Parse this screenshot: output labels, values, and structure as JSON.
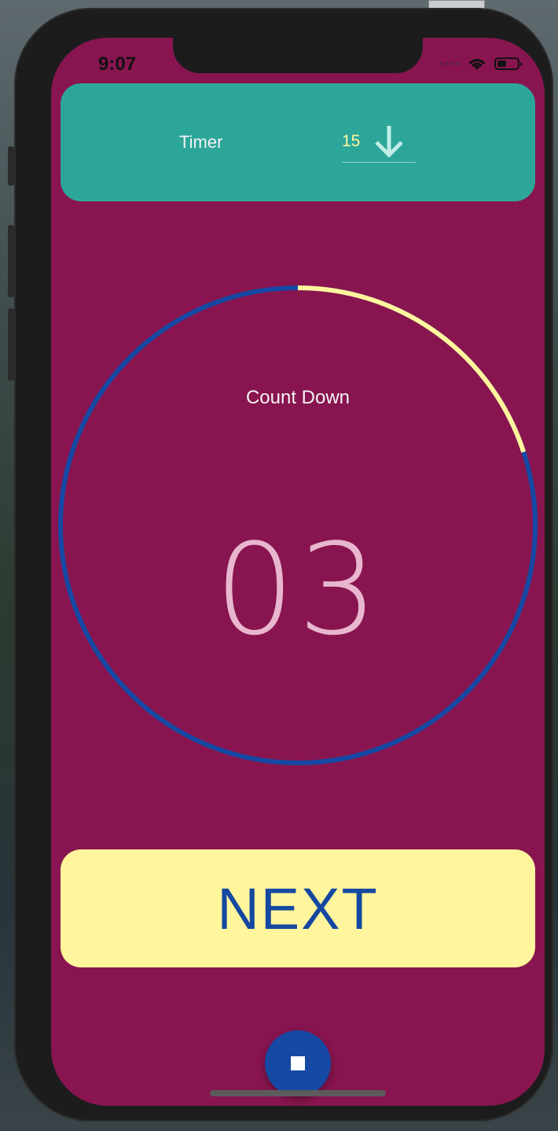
{
  "status_bar": {
    "time": "9:07"
  },
  "timer_card": {
    "label": "Timer",
    "selected_value": "15",
    "icon": "arrow-down-icon"
  },
  "countdown": {
    "label": "Count Down",
    "value": "03",
    "ring_progress_remaining": 0.2,
    "colors": {
      "track": "#1549a4",
      "progress": "#fff59d"
    }
  },
  "next_button": {
    "label": "NEXT"
  },
  "fab": {
    "icon": "stop-icon"
  },
  "colors": {
    "background": "#88154f",
    "timer_card": "#2da69a",
    "next_button": "#fff59d",
    "accent_blue": "#1549a4"
  }
}
